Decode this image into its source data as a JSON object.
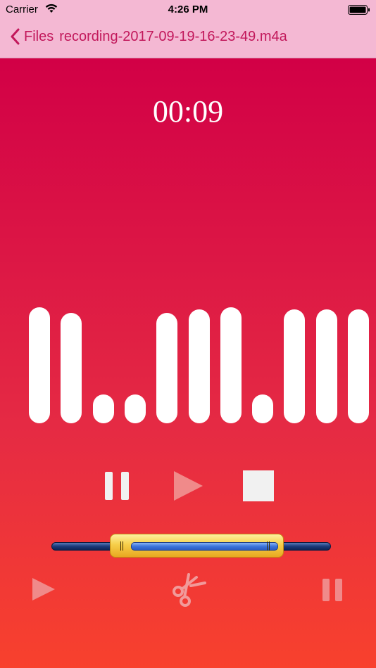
{
  "status_bar": {
    "carrier": "Carrier",
    "time": "4:26 PM",
    "wifi_icon": "wifi-icon",
    "battery_icon": "battery-icon"
  },
  "nav": {
    "back_label": "Files",
    "back_icon": "chevron-left-icon",
    "title": "recording-2017-09-19-16-23-49.m4a"
  },
  "recorder": {
    "elapsed": "00:09",
    "levels": [
      1.0,
      0.95,
      0.25,
      0.25,
      0.95,
      0.98,
      1.0,
      0.25,
      0.98,
      0.98,
      0.98
    ],
    "controls": [
      "pause-icon",
      "play-icon",
      "stop-icon"
    ]
  },
  "trimmer": {
    "selection_start": 0.22,
    "selection_end": 0.82
  },
  "bottom_controls": [
    "play-icon",
    "scissors-icon",
    "pause-icon"
  ],
  "colors": {
    "nav_background": "#f4b8d3",
    "nav_tint": "#c2185b",
    "gradient_top": "#d20046",
    "gradient_bottom": "#f8412d"
  }
}
